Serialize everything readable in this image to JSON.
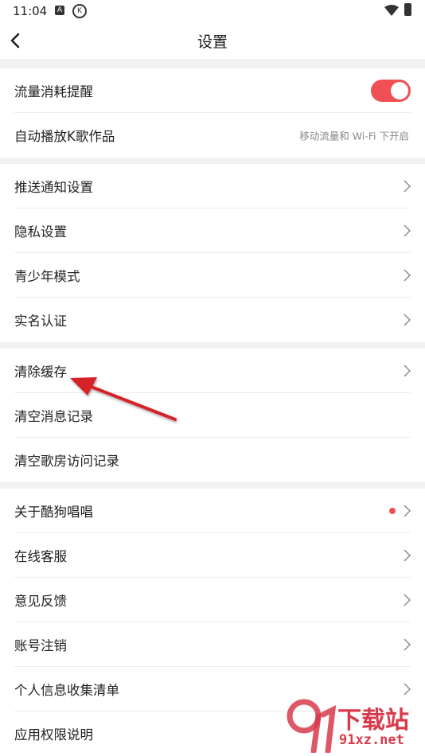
{
  "status_bar": {
    "time": "11:04",
    "a_badge": "A",
    "k_badge": "K"
  },
  "header": {
    "title": "设置"
  },
  "groups": {
    "g1": [
      {
        "label": "流量消耗提醒",
        "toggle_on": true
      },
      {
        "label": "自动播放K歌作品",
        "hint": "移动流量和 Wi-Fi 下开启"
      }
    ],
    "g2": [
      {
        "label": "推送通知设置"
      },
      {
        "label": "隐私设置"
      },
      {
        "label": "青少年模式"
      },
      {
        "label": "实名认证"
      }
    ],
    "g3": [
      {
        "label": "清除缓存"
      },
      {
        "label": "清空消息记录"
      },
      {
        "label": "清空歌房访问记录"
      }
    ],
    "g4": [
      {
        "label": "关于酷狗唱唱",
        "badge": "red-dot"
      },
      {
        "label": "在线客服"
      },
      {
        "label": "意见反馈"
      },
      {
        "label": "账号注销"
      },
      {
        "label": "个人信息收集清单"
      },
      {
        "label": "应用权限说明"
      }
    ]
  },
  "watermark": {
    "word": "下载站",
    "domain": "91xz.net"
  },
  "colors": {
    "accent": "#ef4f55",
    "background": "#ffffff",
    "divider_band": "#f2f2f2",
    "annotation_arrow": "#d42027"
  }
}
